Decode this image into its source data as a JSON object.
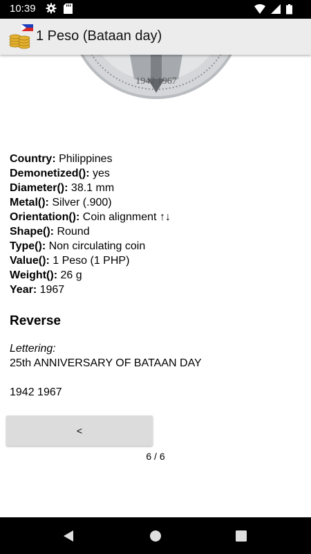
{
  "status_bar": {
    "time": "10:39",
    "icons": [
      "gear-icon",
      "sd-card-icon",
      "wifi-icon",
      "signal-icon",
      "battery-icon"
    ]
  },
  "app_bar": {
    "title": "1 Peso (Bataan day)",
    "logo_icon": "coins-with-flag-icon"
  },
  "coin_image": {
    "years_text": "1942 1967"
  },
  "properties": [
    {
      "key": "Country:",
      "value": " Philippines"
    },
    {
      "key": "Demonetized():",
      "value": " yes"
    },
    {
      "key": "Diameter():",
      "value": " 38.1 mm"
    },
    {
      "key": "Metal():",
      "value": " Silver (.900)"
    },
    {
      "key": "Orientation():",
      "value": " Coin alignment ↑↓"
    },
    {
      "key": "Shape():",
      "value": " Round"
    },
    {
      "key": "Type():",
      "value": " Non circulating coin"
    },
    {
      "key": "Value():",
      "value": " 1 Peso (1 PHP)"
    },
    {
      "key": "Weight():",
      "value": " 26 g"
    },
    {
      "key": "Year:",
      "value": " 1967"
    }
  ],
  "reverse": {
    "title": "Reverse",
    "lettering_label": "Lettering:",
    "lettering_line1": "25th ANNIVERSARY OF BATAAN DAY",
    "lettering_line2": "1942 1967"
  },
  "navigation": {
    "prev_label": "<",
    "page_indicator": "6 / 6"
  },
  "colors": {
    "app_bar": "#ececec",
    "button": "#dcdcdc",
    "system_bars": "#000000"
  }
}
